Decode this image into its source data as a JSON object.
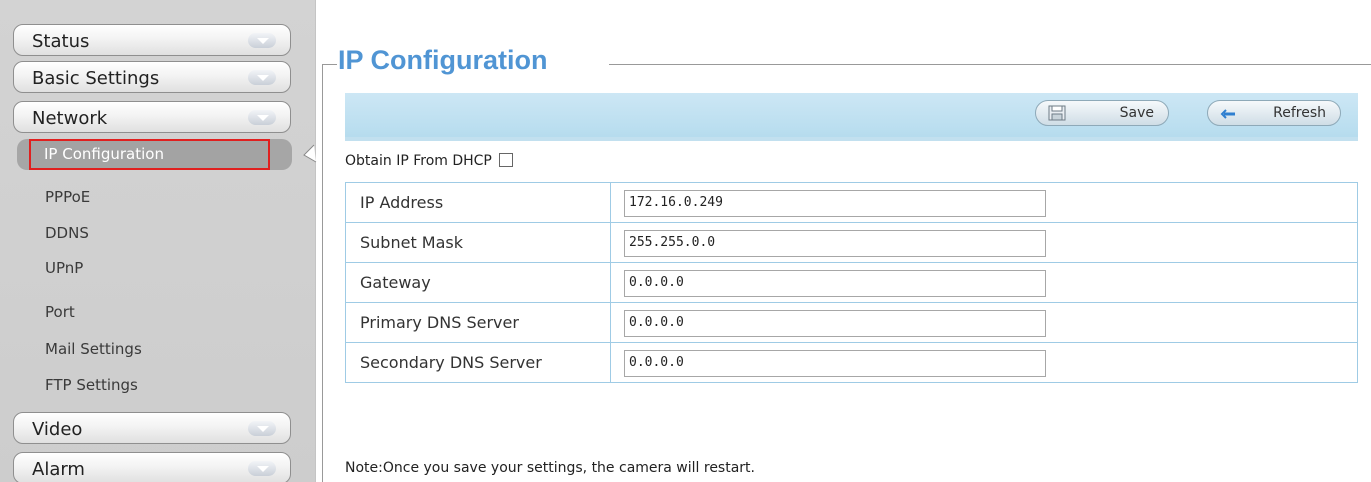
{
  "sidebar": {
    "menus": [
      {
        "label": "Status"
      },
      {
        "label": "Basic Settings"
      },
      {
        "label": "Network"
      },
      {
        "label": "Video"
      },
      {
        "label": "Alarm"
      }
    ],
    "network_items": [
      {
        "label": "IP Configuration",
        "active": true
      },
      {
        "label": "PPPoE"
      },
      {
        "label": "DDNS"
      },
      {
        "label": "UPnP"
      },
      {
        "label": "Port"
      },
      {
        "label": "Mail Settings"
      },
      {
        "label": "FTP Settings"
      }
    ]
  },
  "page": {
    "title": "IP Configuration",
    "toolbar": {
      "save_label": "Save",
      "refresh_label": "Refresh"
    },
    "dhcp_label": "Obtain IP From DHCP",
    "dhcp_checked": false,
    "fields": [
      {
        "label": "IP Address",
        "value": "172.16.0.249"
      },
      {
        "label": "Subnet Mask",
        "value": "255.255.0.0"
      },
      {
        "label": "Gateway",
        "value": "0.0.0.0"
      },
      {
        "label": "Primary DNS Server",
        "value": "0.0.0.0"
      },
      {
        "label": "Secondary DNS Server",
        "value": "0.0.0.0"
      }
    ],
    "note": "Note:Once you save your settings, the camera will restart."
  },
  "colors": {
    "accent": "#5095d4",
    "highlight": "#e0201f",
    "toolbar": "#bfe0f0"
  },
  "icons": [
    "chevron-down-icon",
    "save-icon",
    "refresh-icon",
    "pointer-icon"
  ]
}
